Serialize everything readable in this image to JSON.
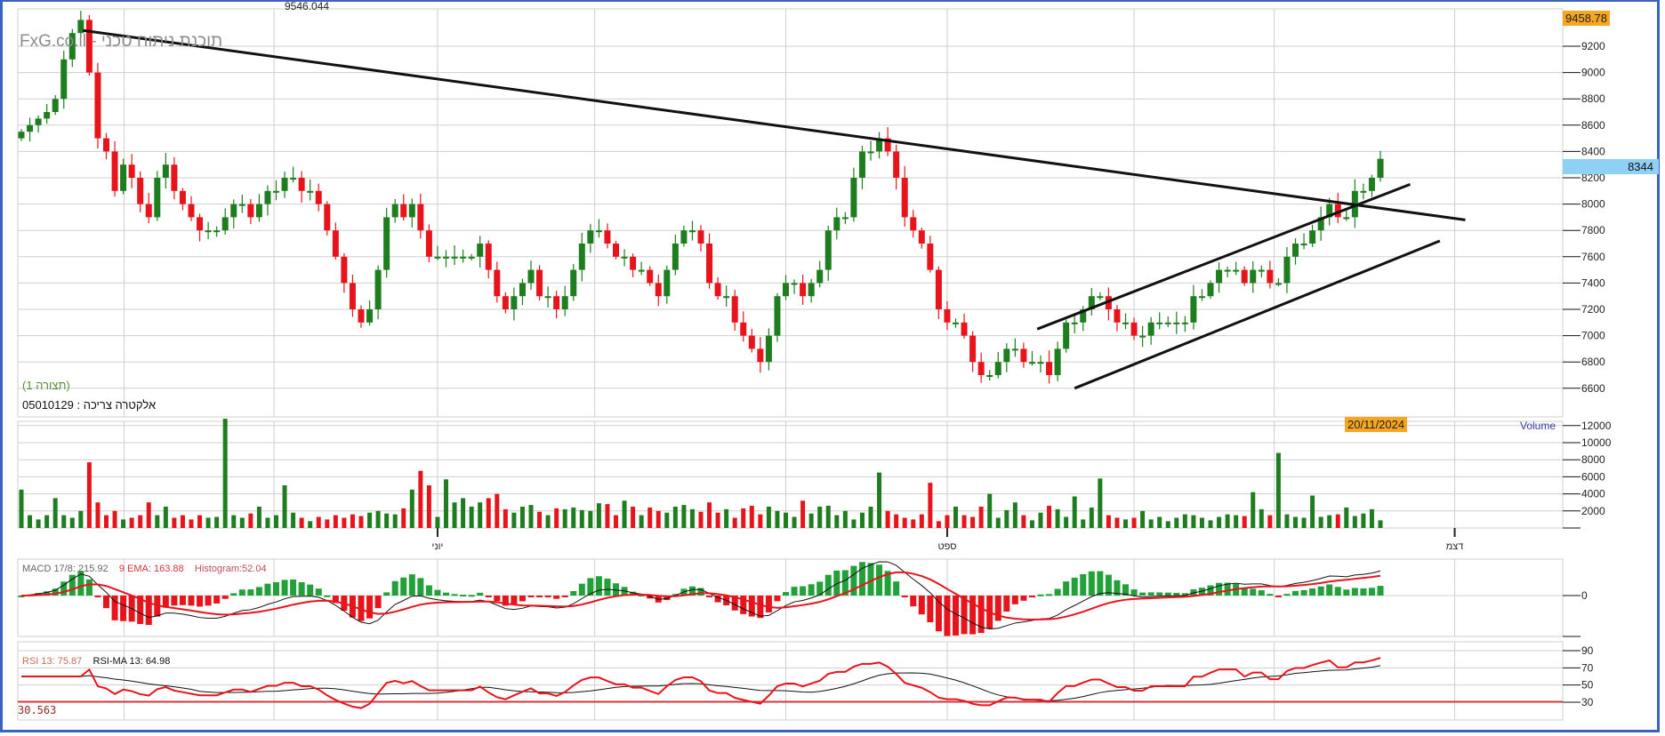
{
  "watermark": "FxG.co.il - תוכנת ניתוח טכני",
  "top_value": "9546.044",
  "high_marker": "9458.78",
  "last_price": "8344",
  "config_label": "(תצורה 1)",
  "instrument": {
    "name": "אלקטרה צריכה",
    "separator": ":",
    "code": "05010129"
  },
  "date_marker": "20/11/2024",
  "volume_label": "Volume",
  "macd_legend": {
    "macd": "MACD 17/8: 215.92",
    "ema": "9 EMA: 163.88",
    "histogram": "Histogram:52.04"
  },
  "rsi_legend": {
    "rsi": "RSI 13: 75.87",
    "ma": "RSI-MA 13: 64.98"
  },
  "rsi_level_label": "30.563",
  "colors": {
    "up": "#1e7d1e",
    "down": "#e8141c",
    "frame": "#3a62c0",
    "macd_hist": "#22a03a"
  },
  "chart_data": [
    {
      "type": "candlestick",
      "title": "אלקטרה צריכה",
      "ylim": [
        6500,
        9500
      ],
      "y_ticks": [
        9200,
        9000,
        8800,
        8600,
        8400,
        8200,
        8000,
        7800,
        7600,
        7400,
        7200,
        7000,
        6800,
        6600
      ],
      "x_month_labels": [
        "יוני",
        "ספט",
        "דצמ"
      ],
      "close": [
        8550,
        8600,
        8650,
        8700,
        8800,
        9100,
        9300,
        9400,
        9000,
        8500,
        8400,
        8100,
        8300,
        8200,
        8000,
        7900,
        8200,
        8300,
        8100,
        8000,
        7900,
        7800,
        7800,
        7800,
        7900,
        8000,
        8000,
        7900,
        8000,
        8100,
        8100,
        8200,
        8200,
        8100,
        8100,
        8000,
        7800,
        7600,
        7400,
        7200,
        7100,
        7200,
        7500,
        7900,
        8000,
        7900,
        8000,
        7800,
        7600,
        7600,
        7600,
        7600,
        7600,
        7600,
        7700,
        7500,
        7300,
        7200,
        7300,
        7400,
        7500,
        7300,
        7300,
        7200,
        7300,
        7500,
        7700,
        7800,
        7800,
        7700,
        7600,
        7600,
        7500,
        7500,
        7400,
        7300,
        7500,
        7700,
        7800,
        7800,
        7700,
        7400,
        7300,
        7300,
        7100,
        7000,
        6900,
        6800,
        7000,
        7300,
        7400,
        7400,
        7300,
        7400,
        7500,
        7800,
        7900,
        7900,
        8200,
        8400,
        8400,
        8500,
        8400,
        8200,
        7900,
        7800,
        7700,
        7500,
        7200,
        7100,
        7100,
        7000,
        6800,
        6700,
        6700,
        6800,
        6900,
        6900,
        6800,
        6800,
        6800,
        6700,
        6900,
        7100,
        7100,
        7200,
        7300,
        7300,
        7200,
        7100,
        7100,
        7000,
        7000,
        7100,
        7100,
        7100,
        7100,
        7100,
        7300,
        7300,
        7400,
        7500,
        7500,
        7500,
        7400,
        7500,
        7500,
        7400,
        7400,
        7600,
        7700,
        7700,
        7800,
        7900,
        8000,
        7900,
        7900,
        8100,
        8100,
        8200,
        8344
      ],
      "trendlines": [
        {
          "name": "downtrend",
          "from": [
            7.25,
            9320
          ],
          "to": [
            170,
            7880
          ]
        },
        {
          "name": "channel-upper",
          "from": [
            119.6,
            7050
          ],
          "to": [
            163.5,
            8150
          ]
        },
        {
          "name": "channel-lower",
          "from": [
            124,
            6600
          ],
          "to": [
            167,
            7720
          ]
        }
      ]
    },
    {
      "type": "bar",
      "title": "Volume",
      "ylim": [
        0,
        12000
      ],
      "y_ticks": [
        12000,
        10000,
        8000,
        6000,
        4000,
        2000
      ],
      "values": [
        4500,
        1500,
        1000,
        1500,
        3500,
        1500,
        1200,
        2000,
        7700,
        3000,
        1500,
        2000,
        1000,
        1200,
        1500,
        3000,
        1500,
        2500,
        1200,
        1500,
        1000,
        1500,
        1200,
        1300,
        12800,
        1500,
        1200,
        1700,
        2500,
        1200,
        1500,
        5000,
        1800,
        1200,
        800,
        1300,
        1000,
        1500,
        1200,
        1600,
        1400,
        1800,
        2000,
        1700,
        1600,
        2300,
        4500,
        6700,
        5000,
        1300,
        5700,
        3000,
        3500,
        2500,
        3000,
        3500,
        4000,
        2200,
        1800,
        2500,
        2700,
        1900,
        1500,
        2300,
        2200,
        2400,
        2100,
        2000,
        2900,
        2800,
        1500,
        3200,
        2500,
        1500,
        2400,
        2000,
        1800,
        2500,
        2700,
        2200,
        1900,
        3000,
        1800,
        2200,
        1200,
        2300,
        2600,
        1600,
        2500,
        2000,
        1800,
        1300,
        3200,
        1700,
        2500,
        2600,
        1500,
        2000,
        1000,
        1800,
        2500,
        6500,
        2000,
        1600,
        1200,
        1000,
        1600,
        5300,
        800,
        1500,
        2500,
        1500,
        1300,
        2500,
        4000,
        1200,
        2100,
        3000,
        1500,
        900,
        1800,
        2600,
        2200,
        1300,
        3700,
        1000,
        2400,
        5800,
        1500,
        1200,
        1000,
        1200,
        2000,
        1000,
        1300,
        800,
        1200,
        1600,
        1500,
        1200,
        900,
        1300,
        1600,
        1500,
        1400,
        4200,
        2200,
        1500,
        8800,
        1600,
        1300,
        1200,
        3800,
        1300,
        1500,
        1600,
        2400,
        1400,
        1700,
        2200,
        900
      ]
    },
    {
      "type": "line",
      "title": "MACD 17/8",
      "series": [
        "MACD",
        "9 EMA",
        "Histogram"
      ],
      "y_ticks": [
        0
      ]
    },
    {
      "type": "line",
      "title": "RSI 13",
      "series": [
        "RSI 13",
        "RSI-MA 13"
      ],
      "ylim": [
        10,
        90
      ],
      "y_ticks": [
        90,
        70,
        50,
        30
      ],
      "reference_level": 30.563
    }
  ]
}
